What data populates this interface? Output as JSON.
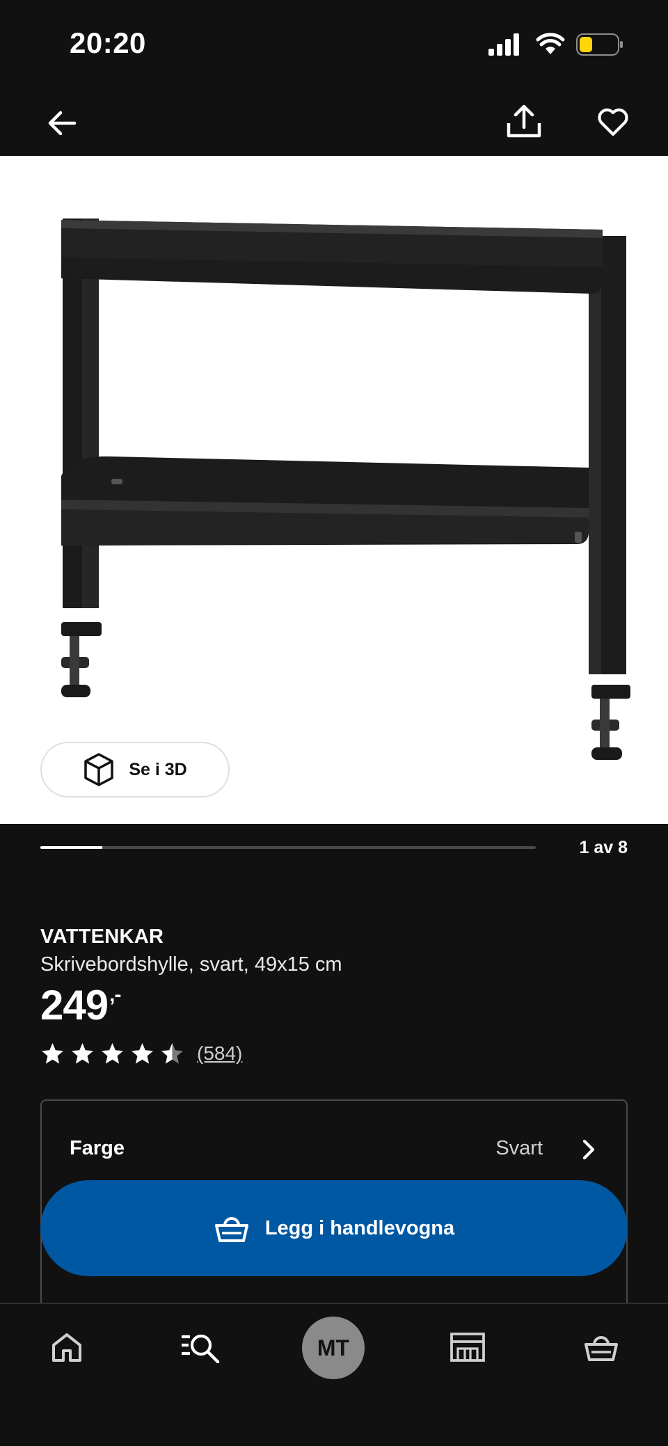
{
  "status_bar": {
    "time": "20:20",
    "battery_level": 0.35,
    "battery_color": "#ffd60a"
  },
  "nav": {
    "back_icon": "arrow-left-icon",
    "share_icon": "share-icon",
    "favorite_icon": "heart-icon"
  },
  "gallery": {
    "view_3d_label": "Se i 3D",
    "view_3d_icon": "cube-icon",
    "image_counter": "1 av 8",
    "progress": 0.125
  },
  "product": {
    "name": "VATTENKAR",
    "description": "Skrivebordshylle, svart, 49x15 cm",
    "price": "249",
    "price_suffix": ",-",
    "rating_stars": 4.5,
    "review_count": "(584)"
  },
  "options": {
    "color_label": "Farge",
    "color_value": "Svart"
  },
  "cta": {
    "add_to_cart_label": "Legg i handlevogna",
    "add_to_cart_icon": "basket-icon",
    "accent_color": "#0058a3"
  },
  "bottom_nav": {
    "items": [
      "home-icon",
      "search-list-icon",
      "profile-avatar",
      "store-icon",
      "basket-icon"
    ],
    "avatar_initials": "MT"
  }
}
